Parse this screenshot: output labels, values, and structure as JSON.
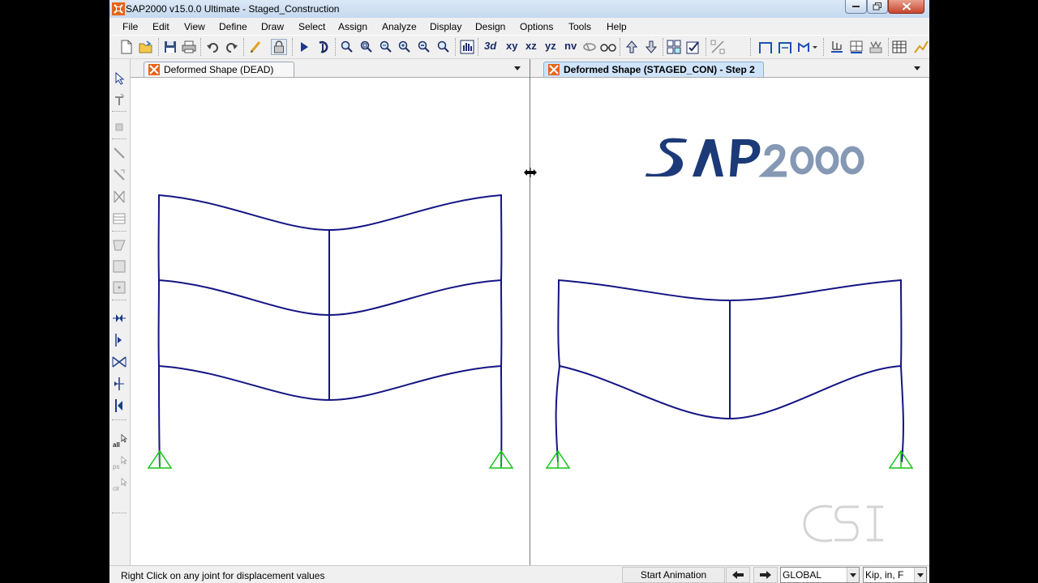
{
  "window": {
    "title": "SAP2000 v15.0.0 Ultimate  -  Staged_Construction"
  },
  "menu": [
    "File",
    "Edit",
    "View",
    "Define",
    "Draw",
    "Select",
    "Assign",
    "Analyze",
    "Display",
    "Design",
    "Options",
    "Tools",
    "Help"
  ],
  "toolbar": {
    "view_buttons": [
      "xy",
      "xz",
      "yz",
      "nv"
    ]
  },
  "side_toolbar": {
    "labels": [
      "all",
      "ps",
      "clr"
    ]
  },
  "panels": {
    "left": {
      "tab_label": "Deformed Shape (DEAD)"
    },
    "right": {
      "tab_label": "Deformed Shape (STAGED_CON) - Step 2"
    }
  },
  "status": {
    "message": "Right Click on any joint for displacement values",
    "start_animation": "Start Animation",
    "coord_system": "GLOBAL",
    "units": "Kip, in, F"
  },
  "colors": {
    "frame": "#141483",
    "support": "#17c417",
    "active_tab": "#cfe4fa",
    "logo_dark": "#1c3a78",
    "logo_light": "#8598b4"
  }
}
